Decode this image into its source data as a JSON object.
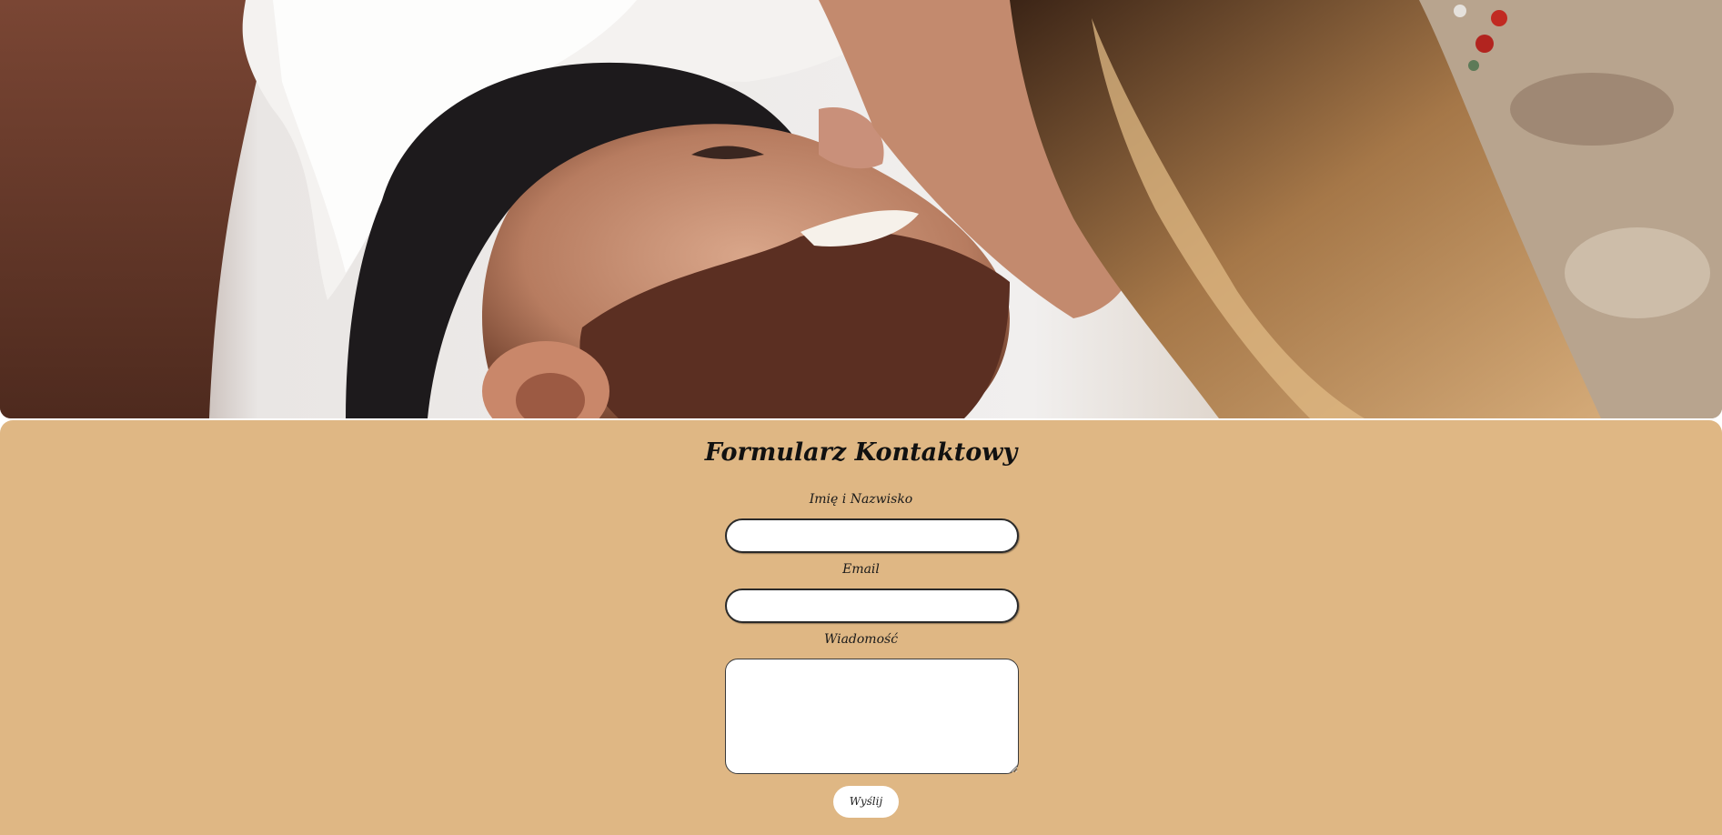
{
  "hero": {
    "image_semantic": "wedding-couple-photo"
  },
  "form": {
    "title": "Formularz Kontaktowy",
    "name_label": "Imię i Nazwisko",
    "name_value": "",
    "email_label": "Email",
    "email_value": "",
    "message_label": "Wiadomość",
    "message_value": "",
    "submit_label": "Wyślij"
  },
  "colors": {
    "panel_background": "#dfb784",
    "input_background": "#ffffff",
    "text": "#111111"
  }
}
